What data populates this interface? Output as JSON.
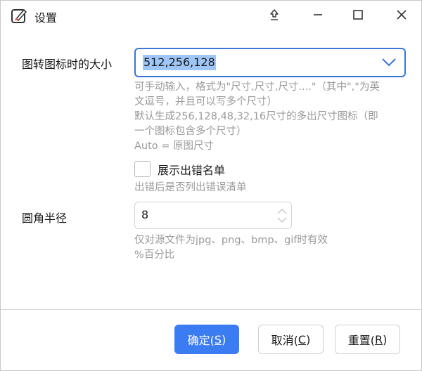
{
  "window": {
    "title": "设置"
  },
  "icons": {
    "app": "app-image-pen-icon",
    "pin": "pin-on-top-icon",
    "minimize": "minimize-icon",
    "maximize": "maximize-icon",
    "close": "close-icon",
    "combo_arrow": "chevron-down-icon",
    "spin_arrows": "spin-arrows-icon"
  },
  "colors": {
    "accent": "#3b7cf2",
    "selection": "#9ec6f7",
    "help_text": "#9a9a9a"
  },
  "form": {
    "size": {
      "label": "图转图标时的大小",
      "value": "512,256,128",
      "help_lines": [
        "可手动输入，格式为\"尺寸,尺寸,尺寸....\"（其中\",\"为英",
        "文逗号，并且可以写多个尺寸）",
        "默认生成256,128,48,32,16尺寸的多出尺寸图标（即",
        "一个图标包含多个尺寸）",
        "Auto = 原图尺寸"
      ]
    },
    "show_error": {
      "label": "展示出错名单",
      "checked": false,
      "help": "出错后是否列出错误清单"
    },
    "radius": {
      "label": "圆角半径",
      "value": "8",
      "help_lines": [
        "仅对源文件为jpg、png、bmp、gif时有效",
        "%百分比"
      ]
    }
  },
  "buttons": {
    "ok": {
      "text": "确定(",
      "mnemonic": "S",
      "close": ")"
    },
    "cancel": {
      "text": "取消(",
      "mnemonic": "C",
      "close": ")"
    },
    "reset": {
      "text": "重置(",
      "mnemonic": "R",
      "close": ")"
    }
  }
}
